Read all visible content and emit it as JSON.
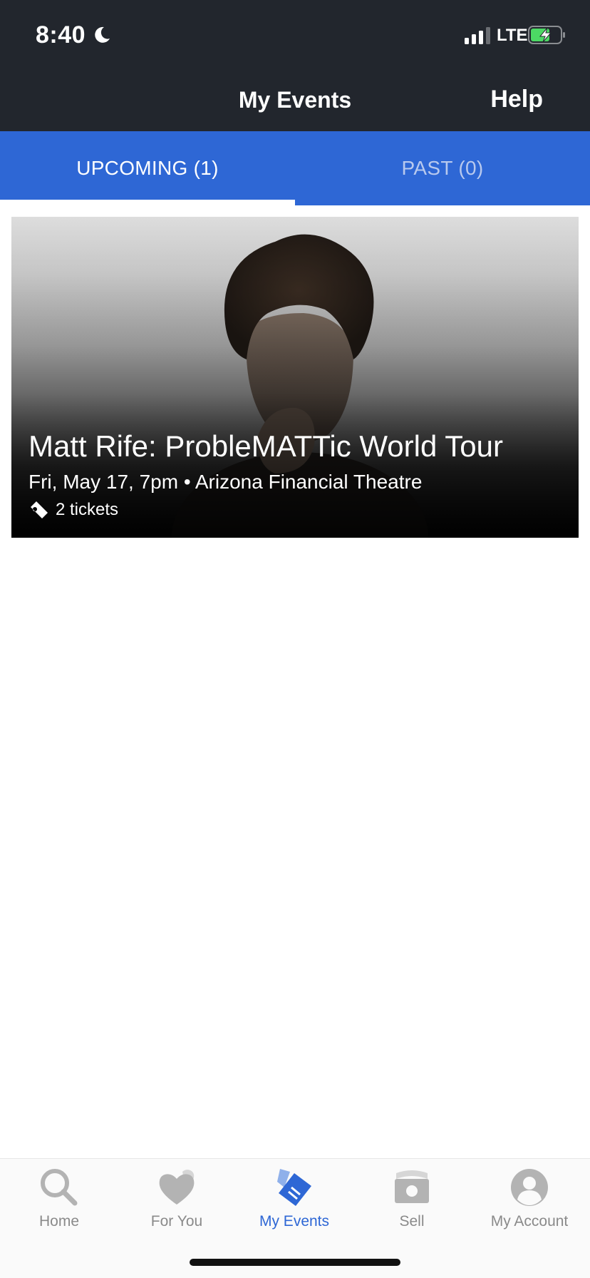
{
  "status_bar": {
    "time": "8:40",
    "network": "LTE"
  },
  "header": {
    "title": "My Events",
    "help_label": "Help"
  },
  "tabs": [
    {
      "label": "UPCOMING (1)",
      "active": true
    },
    {
      "label": "PAST (0)",
      "active": false
    }
  ],
  "event": {
    "title": "Matt Rife: ProbleMATTic World Tour",
    "details": "Fri, May 17, 7pm • Arizona Financial Theatre",
    "tickets": "2 tickets"
  },
  "bottom_nav": [
    {
      "label": "Home",
      "icon": "search-icon",
      "active": false
    },
    {
      "label": "For You",
      "icon": "heart-icon",
      "active": false
    },
    {
      "label": "My Events",
      "icon": "tickets-icon",
      "active": true
    },
    {
      "label": "Sell",
      "icon": "money-icon",
      "active": false
    },
    {
      "label": "My Account",
      "icon": "account-icon",
      "active": false
    }
  ],
  "colors": {
    "header_bg": "#22262d",
    "accent": "#2e67d5",
    "battery_green": "#4cd964"
  }
}
